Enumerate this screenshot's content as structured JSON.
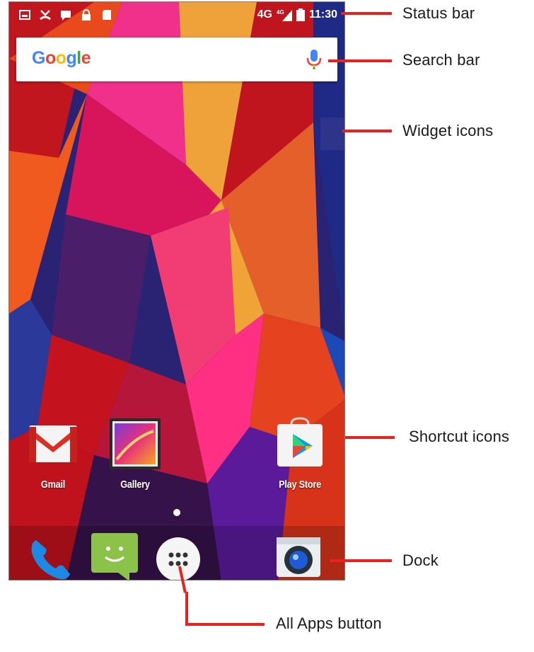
{
  "status_bar": {
    "network": "4G",
    "network_sup": "4G",
    "time": "11:30"
  },
  "search": {
    "logo_text": [
      "G",
      "o",
      "o",
      "g",
      "l",
      "e"
    ],
    "logo_colors": [
      "#4285F4",
      "#EA4335",
      "#FBBC05",
      "#4285F4",
      "#34A853",
      "#EA4335"
    ]
  },
  "shortcuts": [
    {
      "label": "Gmail",
      "icon": "gmail-icon"
    },
    {
      "label": "Gallery",
      "icon": "gallery-icon"
    },
    {
      "label": "Play Store",
      "icon": "play-store-icon"
    }
  ],
  "dock": [
    {
      "icon": "phone-icon"
    },
    {
      "icon": "messaging-icon"
    },
    {
      "icon": "all-apps-icon"
    },
    {
      "icon": "camera-icon"
    }
  ],
  "callouts": {
    "status_bar": "Status bar",
    "search_bar": "Search bar",
    "widget_icons": "Widget icons",
    "shortcut_icons": "Shortcut icons",
    "dock": "Dock",
    "all_apps": "All Apps button"
  },
  "colors": {
    "callout_red": "#e8231f",
    "wallpaper_base": "#1e1a6e"
  }
}
